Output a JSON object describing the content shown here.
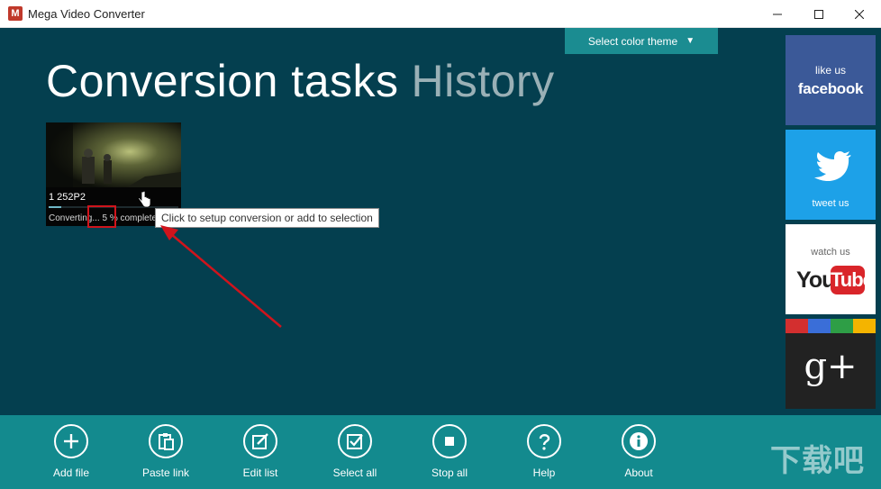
{
  "window": {
    "title": "Mega Video Converter",
    "logo_letter": "M"
  },
  "header": {
    "title": "Conversion tasks",
    "history_tab": "History",
    "theme_button": "Select color theme",
    "theme_caret": "▼"
  },
  "task": {
    "name": "1 252P2",
    "status_prefix": "Converting... ",
    "percent": "5 %",
    "status_suffix": " complete",
    "progress_fraction": 0.05
  },
  "tooltip": "Click to setup conversion or add to selection",
  "social": {
    "facebook": {
      "line1": "like us",
      "line2": "facebook"
    },
    "twitter": {
      "line1": "tweet us"
    },
    "youtube": {
      "line1": "watch us",
      "you": "You",
      "tube": "Tube"
    },
    "googleplus": {
      "text": "g+"
    }
  },
  "toolbar": {
    "items": [
      {
        "label": "Add file",
        "icon": "plus-icon"
      },
      {
        "label": "Paste link",
        "icon": "clipboard-icon"
      },
      {
        "label": "Edit list",
        "icon": "edit-icon"
      },
      {
        "label": "Select all",
        "icon": "checkbox-icon"
      },
      {
        "label": "Stop all",
        "icon": "stop-icon"
      },
      {
        "label": "Help",
        "icon": "question-icon"
      },
      {
        "label": "About",
        "icon": "info-icon"
      }
    ]
  },
  "watermark": "下载吧",
  "colors": {
    "main_bg": "#043f4f",
    "toolbar_bg": "#138a8e",
    "theme_button": "#1b8c91",
    "facebook": "#3b5998",
    "twitter": "#1da1e8",
    "youtube_red": "#d9252a",
    "highlight": "#d0141c"
  }
}
